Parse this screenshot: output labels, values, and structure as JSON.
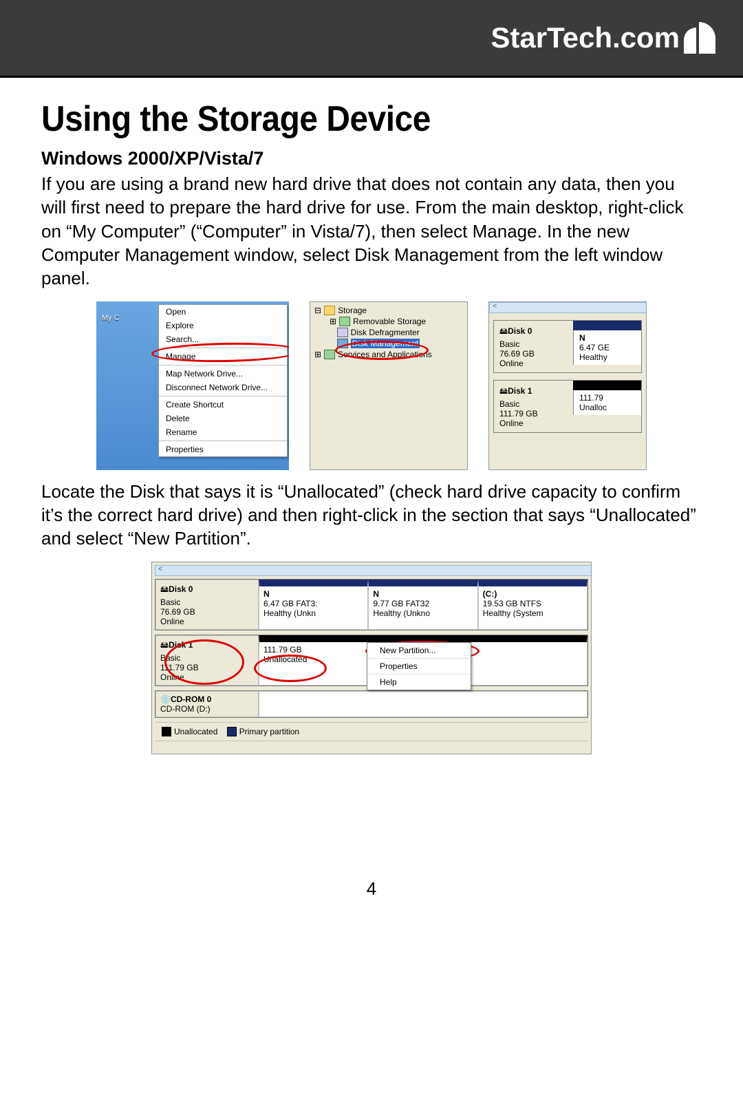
{
  "brand": "StarTech.com",
  "heading": "Using the Storage Device",
  "subheading": "Windows 2000/XP/Vista/7",
  "para1": "If you are using a brand new hard drive that does not contain any data, then you will first need to prepare the hard drive for use.  From the main desktop, right-click on “My Computer” (“Computer” in Vista/7), then select Manage. In the new Computer Management window, select Disk Management from the left window panel.",
  "para2": "Locate the Disk that says it is “Unallocated” (check hard drive capacity to confirm it’s the correct hard drive) and then right-click in the section that says “Unallocated” and select “New Partition”.",
  "page_number": "4",
  "fig1": {
    "icon_label": "My C",
    "menu": [
      "Open",
      "Explore",
      "Search...",
      "Manage",
      "Map Network Drive...",
      "Disconnect Network Drive...",
      "Create Shortcut",
      "Delete",
      "Rename",
      "Properties"
    ]
  },
  "fig2": {
    "root": "Storage",
    "items": [
      "Removable Storage",
      "Disk Defragmenter",
      "Disk Management"
    ],
    "services": "Services and Applications"
  },
  "fig3": {
    "disk0": {
      "title": "Disk 0",
      "type": "Basic",
      "size": "76.69 GB",
      "status": "Online",
      "part_label": "N",
      "part_size": "6.47 GE",
      "part_status": "Healthy"
    },
    "disk1": {
      "title": "Disk 1",
      "type": "Basic",
      "size": "111.79 GB",
      "status": "Online",
      "part_size": "111.79",
      "part_status": "Unalloc"
    }
  },
  "fig4": {
    "disk0": {
      "title": "Disk 0",
      "type": "Basic",
      "size": "76.69 GB",
      "status": "Online",
      "parts": [
        {
          "label": "N",
          "detail": "6.47 GB FAT3:",
          "status": "Healthy (Unkn"
        },
        {
          "label": "N",
          "detail": "9.77 GB FAT32",
          "status": "Healthy (Unkno"
        },
        {
          "label": "(C:)",
          "detail": "19.53 GB NTFS",
          "status": "Healthy (System"
        }
      ]
    },
    "disk1": {
      "title": "Disk 1",
      "type": "Basic",
      "size": "111.79 GB",
      "status": "Online",
      "part": {
        "size": "111.79 GB",
        "status": "Unallocated"
      }
    },
    "cdrom": {
      "title": "CD-ROM 0",
      "sub": "CD-ROM (D:)"
    },
    "ctx": [
      "New Partition...",
      "Properties",
      "Help"
    ],
    "legend": {
      "a": "Unallocated",
      "b": "Primary partition"
    }
  }
}
